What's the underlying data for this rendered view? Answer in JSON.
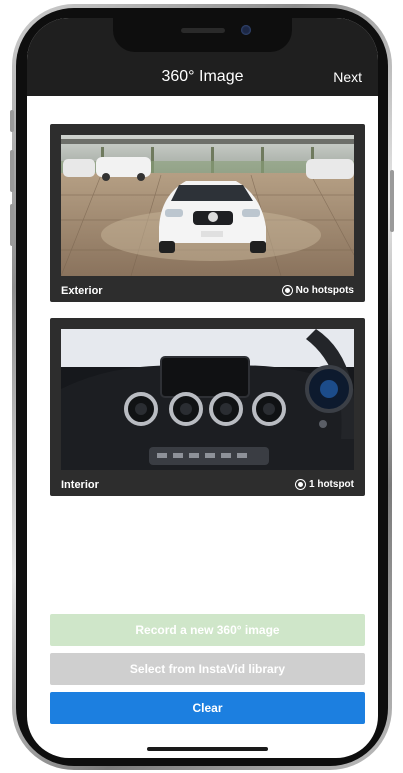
{
  "header": {
    "title": "360° Image",
    "next_label": "Next"
  },
  "cards": [
    {
      "label": "Exterior",
      "hotspots": "No hotspots"
    },
    {
      "label": "Interior",
      "hotspots": "1 hotspot"
    }
  ],
  "actions": {
    "record_label": "Record a new 360° image",
    "library_label": "Select from InstaVid library",
    "clear_label": "Clear"
  },
  "colors": {
    "record_bg": "#cfe6c9",
    "library_bg": "#cfcfcf",
    "clear_bg": "#1c7fe0",
    "header_bg": "#1f1f1f"
  }
}
